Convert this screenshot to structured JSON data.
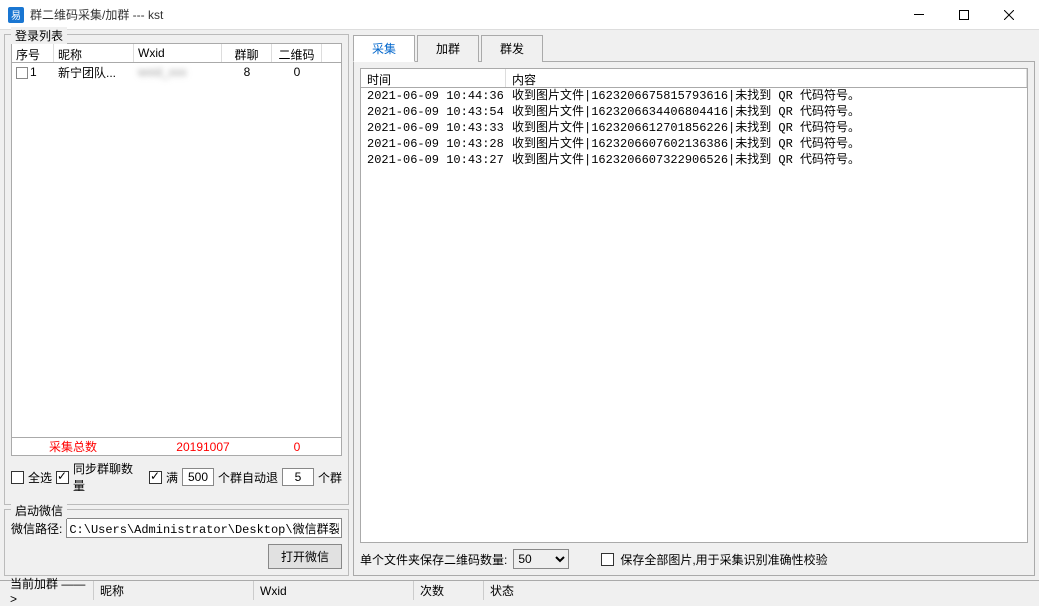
{
  "window": {
    "title": "群二维码采集/加群  --- kst",
    "icon_text": "易"
  },
  "login_list": {
    "title": "登录列表",
    "headers": {
      "seq": "序号",
      "nick": "昵称",
      "wxid": "Wxid",
      "group": "群聊",
      "qr": "二维码"
    },
    "rows": [
      {
        "seq": "1",
        "nick": "新宁团队...",
        "wxid": "",
        "group": "8",
        "qr": "0"
      }
    ],
    "summary": {
      "label": "采集总数",
      "count": "20191007",
      "qr": "0"
    }
  },
  "options": {
    "select_all": "全选",
    "sync_group": "同步群聊数量",
    "full": "满",
    "full_value": "500",
    "auto_quit": "个群自动退",
    "auto_quit_value": "5",
    "group_suffix": "个群"
  },
  "wechat": {
    "title": "启动微信",
    "path_label": "微信路径:",
    "path_value": "C:\\Users\\Administrator\\Desktop\\微信群裂变\\微",
    "open_btn": "打开微信"
  },
  "tabs": [
    "采集",
    "加群",
    "群发"
  ],
  "log": {
    "headers": {
      "time": "时间",
      "content": "内容"
    },
    "rows": [
      {
        "time": "2021-06-09 10:44:36",
        "content": "收到图片文件|1623206675815793616|未找到 QR 代码符号。"
      },
      {
        "time": "2021-06-09 10:43:54",
        "content": "收到图片文件|1623206634406804416|未找到 QR 代码符号。"
      },
      {
        "time": "2021-06-09 10:43:33",
        "content": "收到图片文件|1623206612701856226|未找到 QR 代码符号。"
      },
      {
        "time": "2021-06-09 10:43:28",
        "content": "收到图片文件|1623206607602136386|未找到 QR 代码符号。"
      },
      {
        "time": "2021-06-09 10:43:27",
        "content": "收到图片文件|1623206607322906526|未找到 QR 代码符号。"
      }
    ]
  },
  "bottom": {
    "qr_per_folder_label": "单个文件夹保存二维码数量:",
    "qr_per_folder_value": "50",
    "save_all_label": "保存全部图片,用于采集识别准确性校验"
  },
  "statusbar": {
    "current_add": "当前加群 ——>",
    "nick_label": "昵称",
    "wxid_label": "Wxid",
    "count_label": "次数",
    "status_label": "状态"
  }
}
